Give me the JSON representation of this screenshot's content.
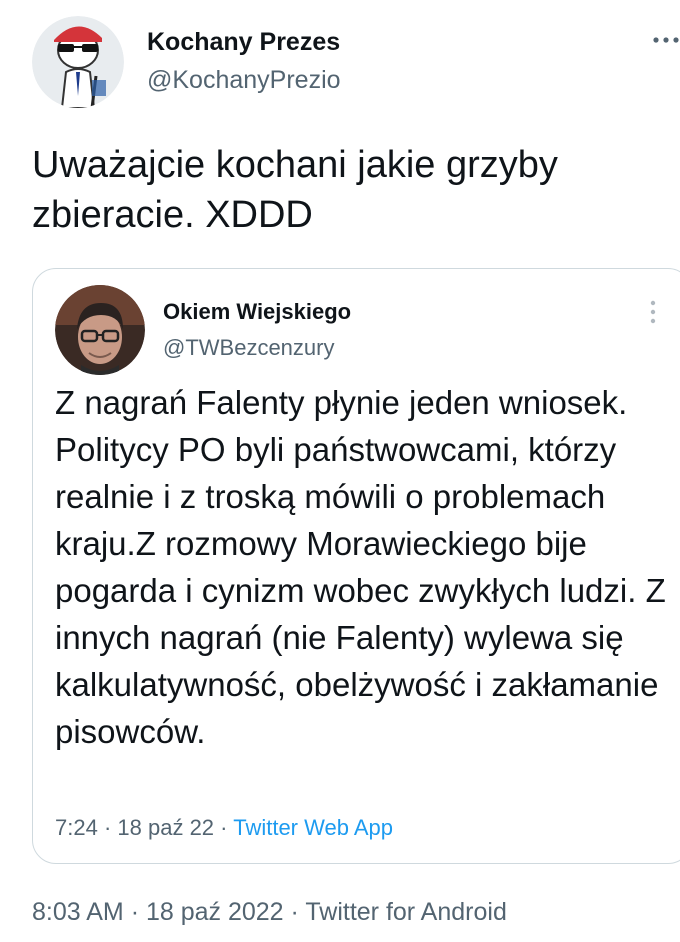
{
  "tweet": {
    "author_name": "Kochany Prezes",
    "author_handle": "@KochanyPrezio",
    "more_icon": "more-horizontal-icon",
    "text": "Uważajcie kochani jakie grzyby zbieracie. XDDD",
    "timestamp": "8:03 AM",
    "date": "18 paź 2022",
    "separator": "·",
    "source": "Twitter for Android"
  },
  "quoted_tweet": {
    "author_name": "Okiem Wiejskiego",
    "author_handle": "@TWBezcenzury",
    "more_icon": "more-vertical-icon",
    "text": "Z nagrań Falenty płynie jeden wniosek. Politycy PO byli państwowcami, którzy realnie i z troską mówili o problemach kraju.Z rozmowy Morawieckiego bije pogarda i cynizm wobec zwykłych ludzi. Z innych nagrań (nie Falenty) wylewa się kalkulatywność, obelżywość i zakłamanie pisowców.",
    "time": "7:24",
    "date": "18 paź 22",
    "separator": "·",
    "source": "Twitter Web App"
  },
  "colors": {
    "text_primary": "#0f1419",
    "text_secondary": "#536471",
    "link": "#1d9bf0",
    "border": "#cfd9de"
  }
}
